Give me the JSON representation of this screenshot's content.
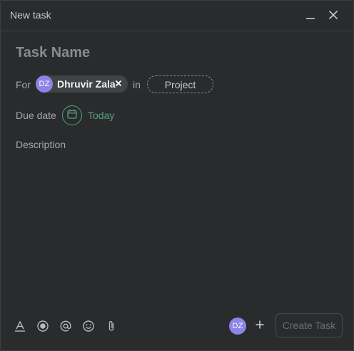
{
  "header": {
    "title": "New task",
    "minimize_icon": "minimize-icon",
    "close_icon": "close-icon"
  },
  "task_name": {
    "placeholder": "Task Name",
    "value": ""
  },
  "assignee": {
    "label": "For",
    "initials": "DZ",
    "name": "Dhruvir Zala",
    "remove_icon": "x-icon",
    "avatar_color": "#8d84e8"
  },
  "project": {
    "label": "in",
    "placeholder": "Project"
  },
  "due_date": {
    "label": "Due date",
    "icon": "calendar-icon",
    "value": "Today",
    "color": "#58a182"
  },
  "description": {
    "placeholder": "Description",
    "value": ""
  },
  "toolbar": {
    "tools": [
      {
        "icon": "text-format-icon"
      },
      {
        "icon": "record-icon"
      },
      {
        "icon": "mention-icon"
      },
      {
        "icon": "emoji-icon"
      },
      {
        "icon": "attachment-icon"
      }
    ]
  },
  "footer": {
    "collaborator_initials": "DZ",
    "add_collaborator_icon": "plus-icon",
    "create_label": "Create Task"
  },
  "colors": {
    "background": "#2a2b2d",
    "border": "#3e3f41",
    "accent_green": "#58a182",
    "avatar_purple": "#8d84e8"
  }
}
